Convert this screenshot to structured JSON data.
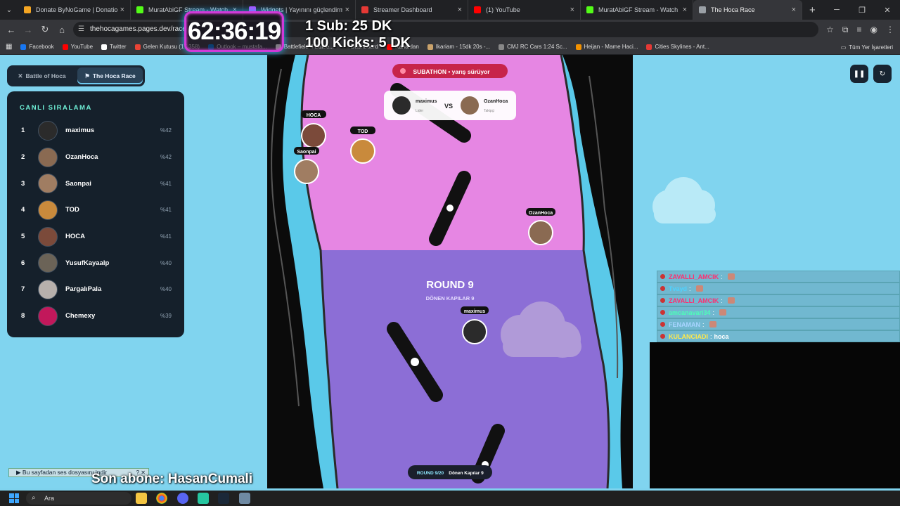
{
  "browser": {
    "tabs": [
      {
        "title": "Donate ByNoGame | Donations",
        "color": "#f5a623"
      },
      {
        "title": "MuratAbiGF Stream - Watch Li...",
        "color": "#53fc18"
      },
      {
        "title": "Widgets | Yayınını güçlendirme...",
        "color": "#b04cff"
      },
      {
        "title": "Streamer Dashboard",
        "color": "#e53935"
      },
      {
        "title": "(1) YouTube",
        "color": "#ff0000"
      },
      {
        "title": "MuratAbiGF Stream - Watch Li...",
        "color": "#53fc18"
      },
      {
        "title": "The Hoca Race",
        "color": "#9aa0a6",
        "active": true
      }
    ],
    "url": "thehocagames.pages.dev/race",
    "bookmarks": [
      {
        "label": "Facebook",
        "color": "#1877f2"
      },
      {
        "label": "YouTube",
        "color": "#ff0000"
      },
      {
        "label": "Twitter",
        "color": "#ffffff"
      },
      {
        "label": "Gelen Kutusu (17.358)",
        "color": "#ea4335"
      },
      {
        "label": "Outlook – mustafa...",
        "color": "#0078d4"
      },
      {
        "label": "Battlefield 4 Battle...",
        "color": "#ffffff"
      },
      {
        "label": "Dashboard",
        "color": "#333333"
      },
      {
        "label": "Kanaldan",
        "color": "#ff0000"
      },
      {
        "label": "Ikariam - 15dk 20s -...",
        "color": "#c9a26b"
      },
      {
        "label": "CMJ RC Cars 1:24 Sc...",
        "color": "#888888"
      },
      {
        "label": "Heijan - Mame Haci...",
        "color": "#f29100"
      },
      {
        "label": "Cities Skylines - Ant...",
        "color": "#e53935"
      }
    ],
    "all_bookmarks": "Tüm Yer İşaretleri"
  },
  "overlay": {
    "timer": "62:36:19",
    "sub_line1": "1 Sub: 25 DK",
    "sub_line2": "100 Kicks: 5 DK",
    "last_sub": "Son abone: HasanCumali",
    "sound_button": "Bu sayfadan ses dosyasını indir"
  },
  "game": {
    "modes": [
      {
        "label": "Battle of Hoca",
        "icon": "swords-icon",
        "active": false
      },
      {
        "label": "The Hoca Race",
        "icon": "flag-icon",
        "active": true
      }
    ],
    "ranking_title": "CANLI SIRALAMA",
    "ranking": [
      {
        "rank": "1",
        "name": "maximus",
        "pct": "%42",
        "color": "#2b2b2b"
      },
      {
        "rank": "2",
        "name": "OzanHoca",
        "pct": "%42",
        "color": "#8a6a52"
      },
      {
        "rank": "3",
        "name": "Saonpai",
        "pct": "%41",
        "color": "#a07d62"
      },
      {
        "rank": "4",
        "name": "TOD",
        "pct": "%41",
        "color": "#c98a3c"
      },
      {
        "rank": "5",
        "name": "HOCA",
        "pct": "%41",
        "color": "#7b4a3a"
      },
      {
        "rank": "6",
        "name": "YusufKayaalp",
        "pct": "%40",
        "color": "#6b6357"
      },
      {
        "rank": "7",
        "name": "PargalıPala",
        "pct": "%40",
        "color": "#b7b0ac"
      },
      {
        "rank": "8",
        "name": "Chemexy",
        "pct": "%39",
        "color": "#c2185b"
      }
    ],
    "subathon_badge": "SUBATHON • yarış sürüyor",
    "vs_card": {
      "left_name": "maximus",
      "left_sub": "Lider",
      "vs": "VS",
      "right_name": "OzanHoca",
      "right_sub": "Takipçi"
    },
    "round_title": "ROUND 9",
    "round_sub": "DÖNEN KAPILAR 9",
    "round_footer": "ROUND 9/20",
    "round_footer_sub": "Dönen Kapılar 9",
    "racers": [
      {
        "name": "HOCA",
        "color": "#7b4a3a"
      },
      {
        "name": "Saonpai",
        "color": "#a07d62"
      },
      {
        "name": "TOD",
        "color": "#c98a3c"
      },
      {
        "name": "OzanHoca",
        "color": "#8a6a52"
      },
      {
        "name": "maximus",
        "color": "#2b2b2b"
      }
    ],
    "controls": [
      {
        "name": "pause-button",
        "icon": "pause-icon",
        "glyph": "❚❚"
      },
      {
        "name": "restart-button",
        "icon": "refresh-icon",
        "glyph": "↻"
      }
    ]
  },
  "chat": [
    {
      "user": "ZAVALLI_AMCIK",
      "user_color": "#ff2d6f",
      "message": ""
    },
    {
      "user": "Tvayd",
      "user_color": "#4dd2ff",
      "message": ""
    },
    {
      "user": "ZAVALLI_AMCIK",
      "user_color": "#ff2d6f",
      "message": ""
    },
    {
      "user": "amcanavari34",
      "user_color": "#4dffb8",
      "message": ""
    },
    {
      "user": "FENAMAN",
      "user_color": "#a8d4ff",
      "message": ""
    },
    {
      "user": "KULANCIADI",
      "user_color": "#ffe94a",
      "message": "hoca"
    }
  ],
  "taskbar": {
    "search_placeholder": "Ara"
  }
}
